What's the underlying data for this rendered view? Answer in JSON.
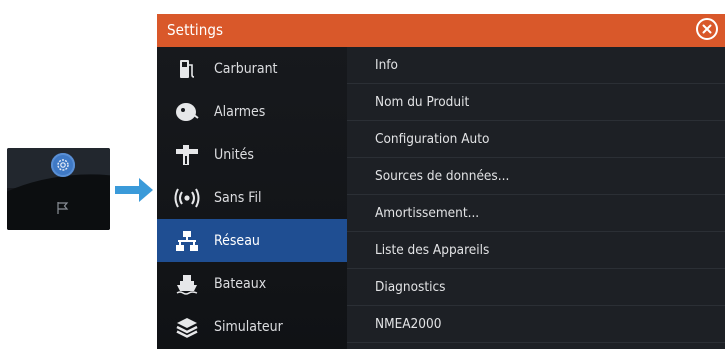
{
  "window": {
    "title": "Settings",
    "title_bar_color": "#d9582a",
    "selection_color": "#1f4e92"
  },
  "nav": [
    {
      "label": "Carburant",
      "icon": "fuel-pump-icon"
    },
    {
      "label": "Alarmes",
      "icon": "alarm-bell-icon"
    },
    {
      "label": "Unités",
      "icon": "units-icon"
    },
    {
      "label": "Sans Fil",
      "icon": "wireless-icon"
    },
    {
      "label": "Réseau",
      "icon": "network-icon",
      "selected": true
    },
    {
      "label": "Bateaux",
      "icon": "vessel-icon"
    },
    {
      "label": "Simulateur",
      "icon": "layers-icon"
    }
  ],
  "submenu": [
    {
      "label": "Info"
    },
    {
      "label": "Nom du Produit"
    },
    {
      "label": "Configuration Auto"
    },
    {
      "label": "Sources de données..."
    },
    {
      "label": "Amortissement..."
    },
    {
      "label": "Liste des Appareils"
    },
    {
      "label": "Diagnostics"
    },
    {
      "label": "NMEA2000"
    }
  ],
  "thumbnail": {
    "icons": [
      "gear-icon",
      "flag-icon"
    ]
  }
}
